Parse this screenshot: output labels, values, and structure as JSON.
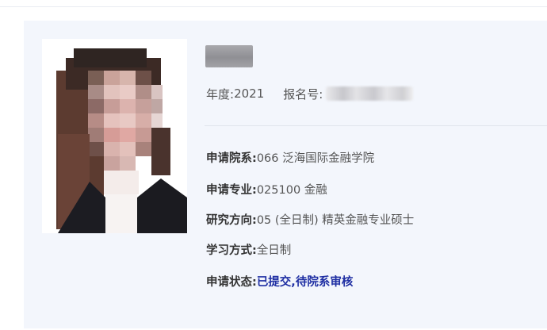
{
  "year": {
    "label": "年度:",
    "value": "2021"
  },
  "registration": {
    "label": "报名号:"
  },
  "fields": [
    {
      "label": "申请院系:",
      "value": "066 泛海国际金融学院"
    },
    {
      "label": "申请专业:",
      "value": "025100 金融"
    },
    {
      "label": "研究方向:",
      "value": "05 (全日制) 精英金融专业硕士"
    },
    {
      "label": "学习方式:",
      "value": "全日制"
    },
    {
      "label": "申请状态:",
      "value": "已提交,待院系审核"
    }
  ],
  "colors": {
    "status": "#1f2fa3",
    "card_background": "#f3f6fc"
  }
}
